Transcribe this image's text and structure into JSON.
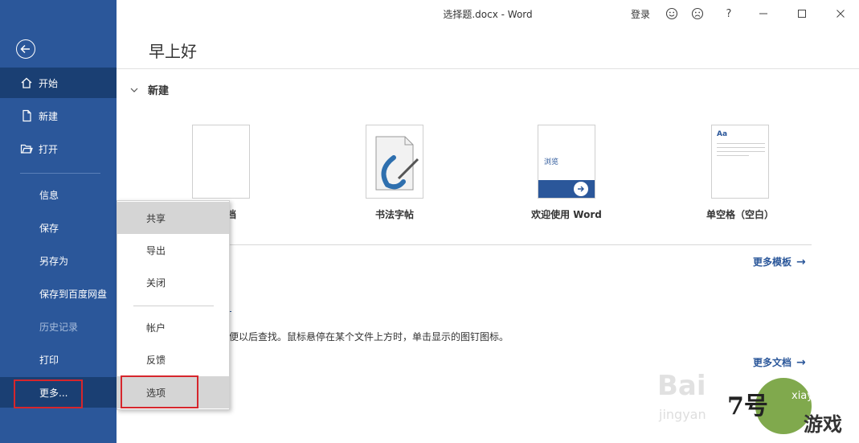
{
  "window": {
    "title": "选择题.docx  -  Word",
    "login": "登录"
  },
  "sidebar": {
    "items": [
      {
        "label": "开始",
        "icon": "home-icon"
      },
      {
        "label": "新建",
        "icon": "new-document-icon"
      },
      {
        "label": "打开",
        "icon": "open-folder-icon"
      },
      {
        "label": "信息"
      },
      {
        "label": "保存"
      },
      {
        "label": "另存为"
      },
      {
        "label": "保存到百度网盘"
      },
      {
        "label": "历史记录"
      },
      {
        "label": "打印"
      },
      {
        "label": "更多..."
      }
    ]
  },
  "main": {
    "greeting": "早上好",
    "new_section": "新建",
    "templates": [
      {
        "label": "档",
        "thumb_text": ""
      },
      {
        "label": "书法字帖",
        "thumb_text": ""
      },
      {
        "label": "欢迎使用 Word",
        "thumb_text": "浏览"
      },
      {
        "label": "单空格（空白）",
        "thumb_text": "Aa"
      }
    ],
    "more_templates": "更多模板",
    "recent_hint": "便以后查找。鼠标悬停在某个文件上方时，单击显示的图钉图标。",
    "more_documents": "更多文档"
  },
  "popup": {
    "items": [
      "共享",
      "导出",
      "关闭",
      "帐户",
      "反馈",
      "选项"
    ]
  },
  "watermarks": {
    "baidu": "Bai",
    "jingyan": "jingyan",
    "site_url": "xiayx.com",
    "site_cn": "游戏",
    "site_num": "7号"
  },
  "colors": {
    "sidebar": "#2b579a",
    "sidebar_active": "#1a3f73",
    "highlight_box": "#d6262c",
    "link": "#2b579a"
  }
}
